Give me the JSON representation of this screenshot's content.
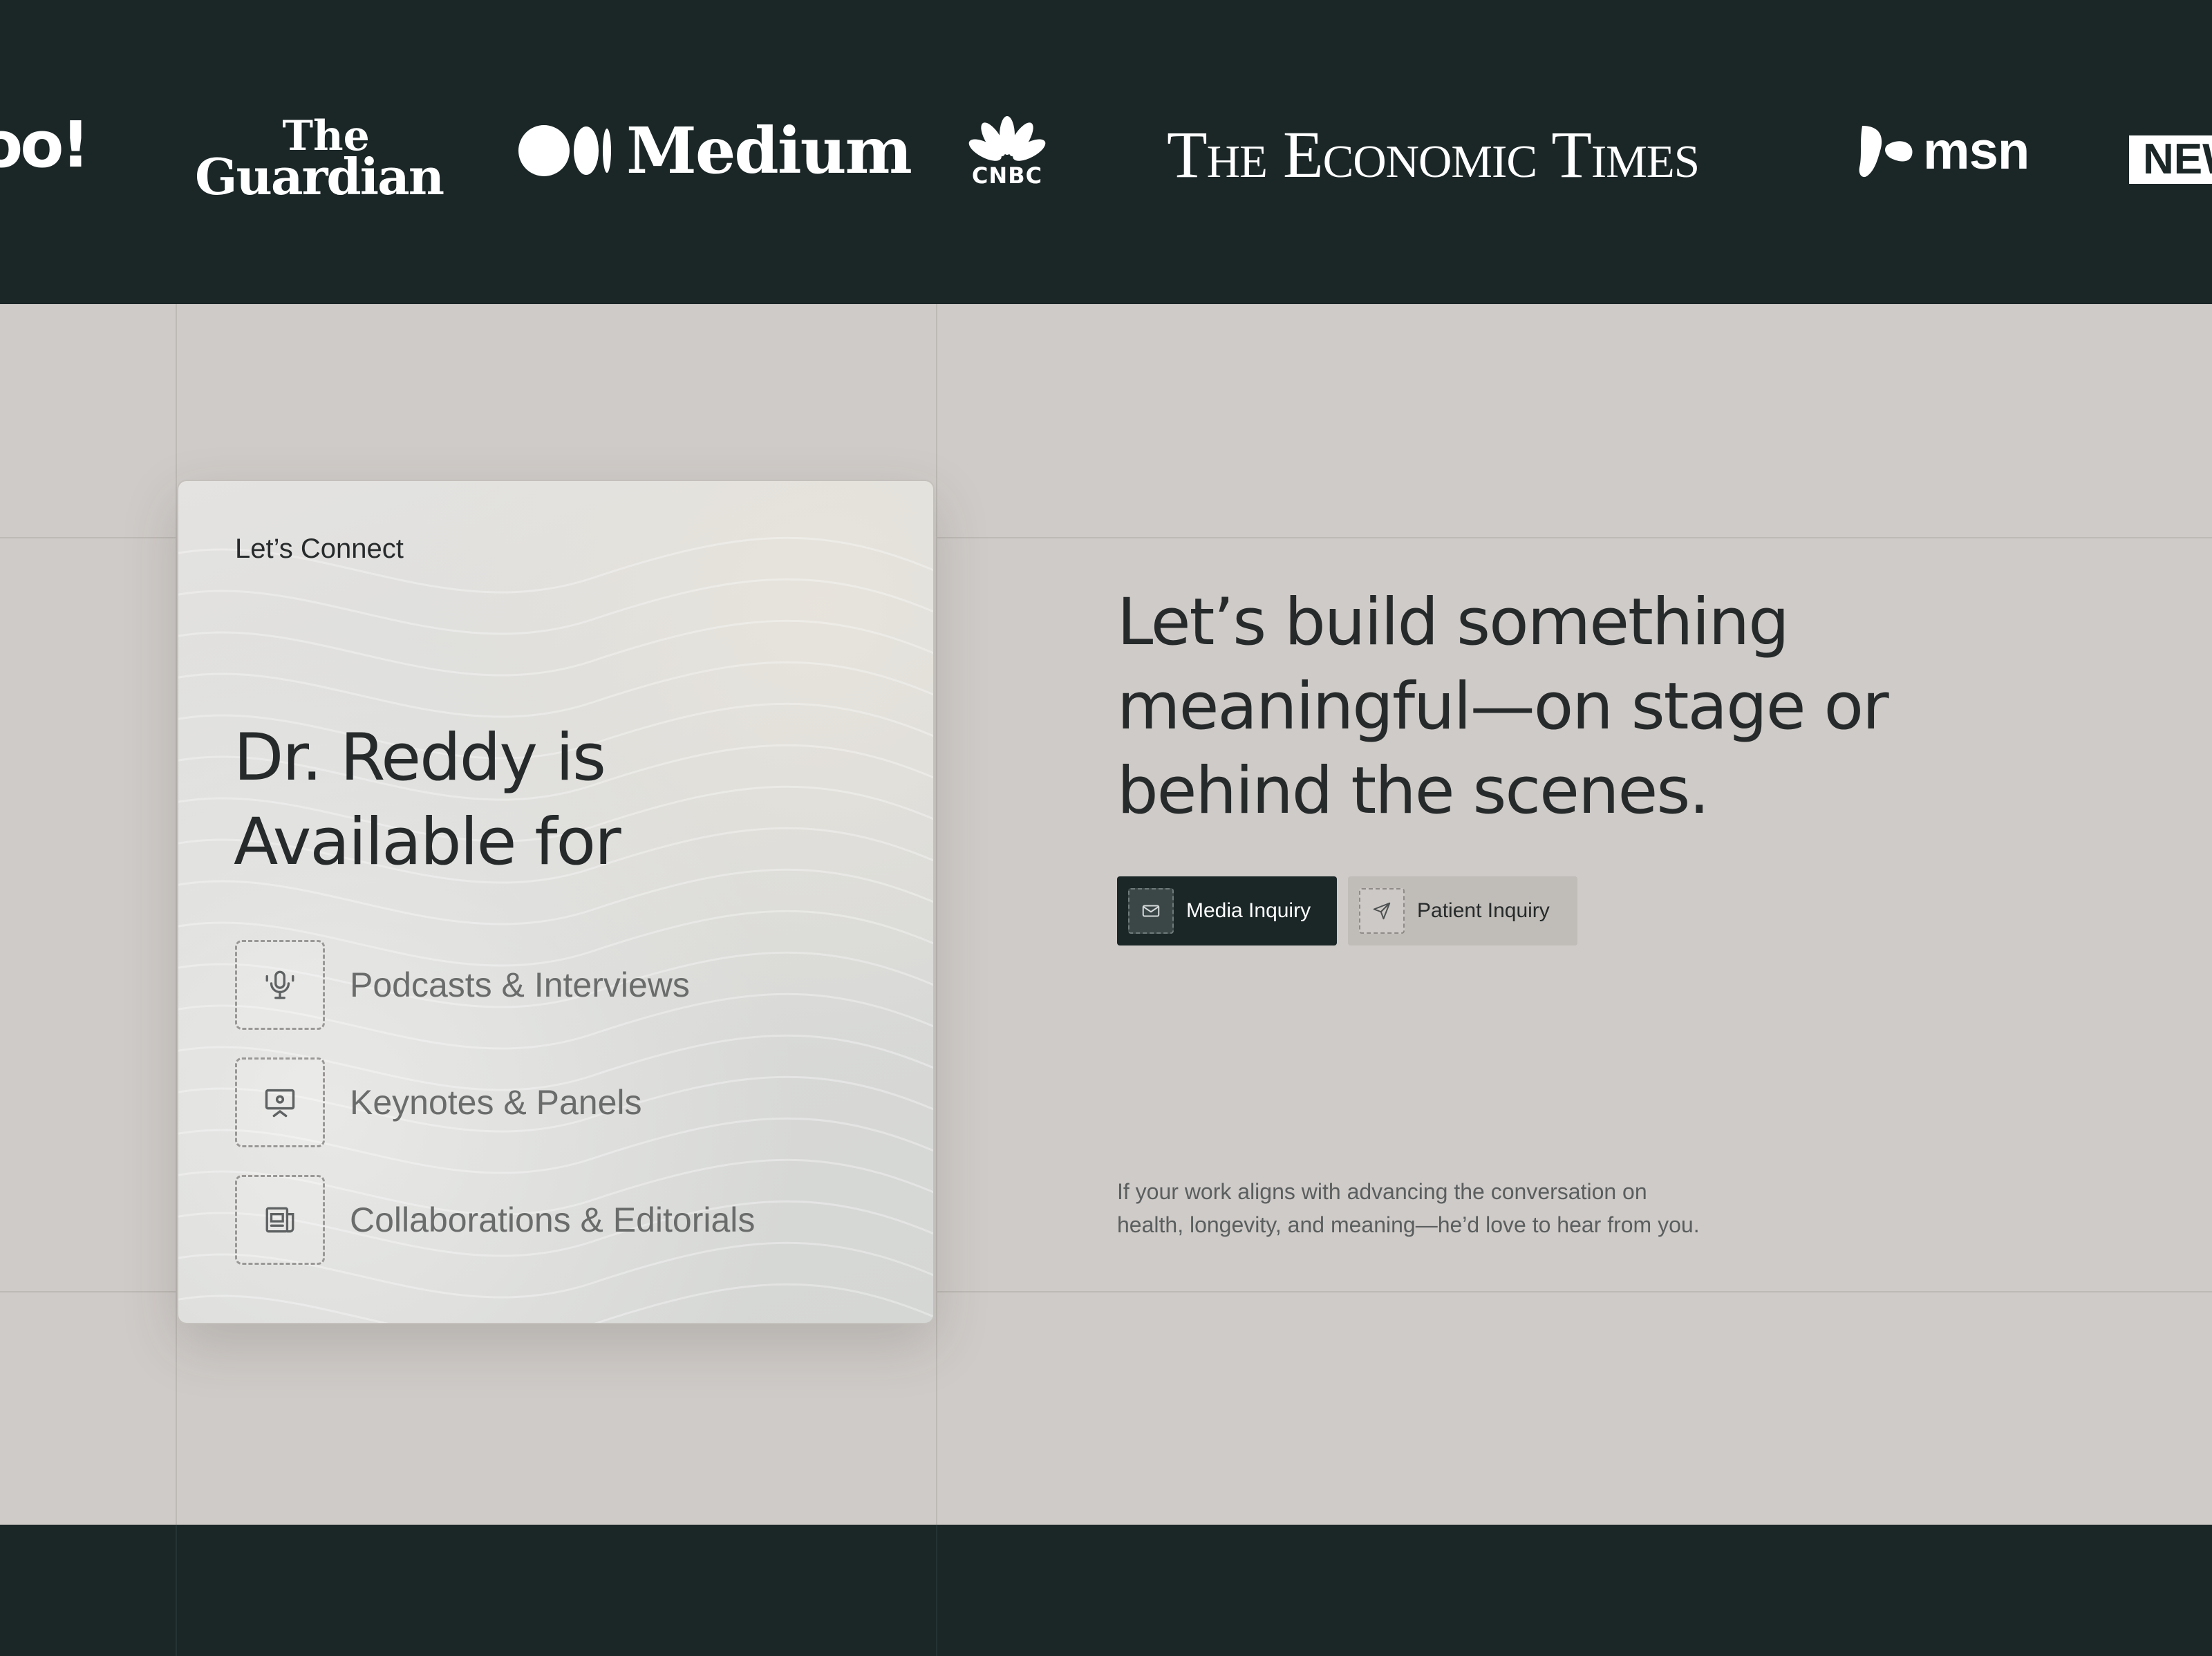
{
  "press": {
    "logos": [
      {
        "name": "yahoo",
        "text": "oo!"
      },
      {
        "name": "the-guardian",
        "line1": "The",
        "line2": "Guardian"
      },
      {
        "name": "medium",
        "text": "Medium"
      },
      {
        "name": "cnbc",
        "text": "CNBC"
      },
      {
        "name": "the-economic-times",
        "text": "The Economic Times"
      },
      {
        "name": "msn",
        "text": "msn"
      },
      {
        "name": "news",
        "text": "NEW"
      }
    ]
  },
  "card": {
    "eyebrow": "Let’s Connect",
    "title": "Dr. Reddy is Available for",
    "offerings": [
      {
        "label": "Podcasts & Interviews",
        "icon": "microphone-icon"
      },
      {
        "label": "Keynotes & Panels",
        "icon": "presentation-screen-icon"
      },
      {
        "label": "Collaborations & Editorials",
        "icon": "newspaper-icon"
      }
    ]
  },
  "contact": {
    "headline": "Let’s build something meaningful—on stage or behind the scenes.",
    "buttons": {
      "media": {
        "label": "Media Inquiry",
        "icon": "mail-icon"
      },
      "patient": {
        "label": "Patient Inquiry",
        "icon": "send-icon"
      }
    },
    "blurb_line1": "If your work aligns with advancing the conversation on",
    "blurb_line2": "health, longevity, and meaning—he’d love to hear from you."
  },
  "colors": {
    "dark": "#1b2627",
    "section_bg": "#cfcbc8",
    "text_primary": "#262a2a",
    "text_muted": "#6a6c6b",
    "secondary_button": "#c0bcb8"
  }
}
